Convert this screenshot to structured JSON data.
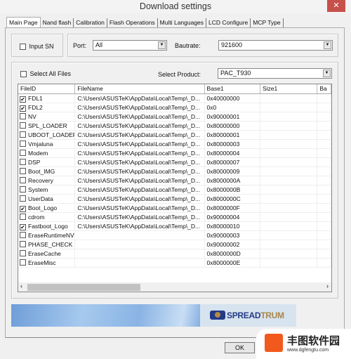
{
  "window": {
    "title": "Download settings",
    "close": "✕"
  },
  "tabs": [
    "Main Page",
    "Nand flash",
    "Calibration",
    "Flash Operations",
    "Multi Languages",
    "LCD Configure",
    "MCP Type"
  ],
  "settings": {
    "input_sn_label": "Input SN",
    "input_sn_checked": false,
    "port_label": "Port:",
    "port_value": "All",
    "baudrate_label": "Bautrate:",
    "baudrate_value": "921600"
  },
  "files": {
    "select_all_label": "Select All Files",
    "select_all_checked": false,
    "product_label": "Select Product:",
    "product_value": "PAC_T930",
    "columns": [
      "FileID",
      "FileName",
      "Base1",
      "Size1",
      "Ba"
    ],
    "rows": [
      {
        "id": "FDL1",
        "checked": true,
        "file": "C:\\Users\\ASUSTeK\\AppData\\Local\\Temp\\_D...",
        "base": "0x40000000"
      },
      {
        "id": "FDL2",
        "checked": true,
        "file": "C:\\Users\\ASUSTeK\\AppData\\Local\\Temp\\_D...",
        "base": "0x0"
      },
      {
        "id": "NV",
        "checked": false,
        "file": "C:\\Users\\ASUSTeK\\AppData\\Local\\Temp\\_D...",
        "base": "0x90000001"
      },
      {
        "id": "SPL_LOADER",
        "checked": false,
        "file": "C:\\Users\\ASUSTeK\\AppData\\Local\\Temp\\_D...",
        "base": "0x80000000"
      },
      {
        "id": "UBOOT_LOADER",
        "checked": false,
        "file": "C:\\Users\\ASUSTeK\\AppData\\Local\\Temp\\_D...",
        "base": "0x80000001"
      },
      {
        "id": "Vmjaluna",
        "checked": false,
        "file": "C:\\Users\\ASUSTeK\\AppData\\Local\\Temp\\_D...",
        "base": "0x80000003"
      },
      {
        "id": "Modem",
        "checked": false,
        "file": "C:\\Users\\ASUSTeK\\AppData\\Local\\Temp\\_D...",
        "base": "0x80000004"
      },
      {
        "id": "DSP",
        "checked": false,
        "file": "C:\\Users\\ASUSTeK\\AppData\\Local\\Temp\\_D...",
        "base": "0x80000007"
      },
      {
        "id": "Boot_IMG",
        "checked": false,
        "file": "C:\\Users\\ASUSTeK\\AppData\\Local\\Temp\\_D...",
        "base": "0x80000009"
      },
      {
        "id": "Recovery",
        "checked": false,
        "file": "C:\\Users\\ASUSTeK\\AppData\\Local\\Temp\\_D...",
        "base": "0x8000000A"
      },
      {
        "id": "System",
        "checked": false,
        "file": "C:\\Users\\ASUSTeK\\AppData\\Local\\Temp\\_D...",
        "base": "0x8000000B"
      },
      {
        "id": "UserData",
        "checked": false,
        "file": "C:\\Users\\ASUSTeK\\AppData\\Local\\Temp\\_D...",
        "base": "0x8000000C"
      },
      {
        "id": "Boot_Logo",
        "checked": true,
        "file": "C:\\Users\\ASUSTeK\\AppData\\Local\\Temp\\_D...",
        "base": "0x8000000F"
      },
      {
        "id": "cdrom",
        "checked": false,
        "file": "C:\\Users\\ASUSTeK\\AppData\\Local\\Temp\\_D...",
        "base": "0x90000004"
      },
      {
        "id": "Fastboot_Logo",
        "checked": true,
        "file": "C:\\Users\\ASUSTeK\\AppData\\Local\\Temp\\_D...",
        "base": "0x80000010"
      },
      {
        "id": "EraseRuntimeNV",
        "checked": false,
        "file": "",
        "base": "0x90000003"
      },
      {
        "id": "PHASE_CHECK",
        "checked": false,
        "file": "",
        "base": "0x90000002"
      },
      {
        "id": "EraseCache",
        "checked": false,
        "file": "",
        "base": "0x8000000D"
      },
      {
        "id": "EraseMisc",
        "checked": false,
        "file": "",
        "base": "0x8000000E"
      }
    ]
  },
  "banner": {
    "logo_text_a": "SPREAD",
    "logo_text_b": "TRUM"
  },
  "buttons": {
    "ok": "OK"
  },
  "watermark": {
    "text": "丰图软件园",
    "url": "www.dgfengtu.com"
  },
  "colors": {
    "close": "#c7504a",
    "logo_blue": "#253a87",
    "logo_gold": "#a8874a"
  }
}
